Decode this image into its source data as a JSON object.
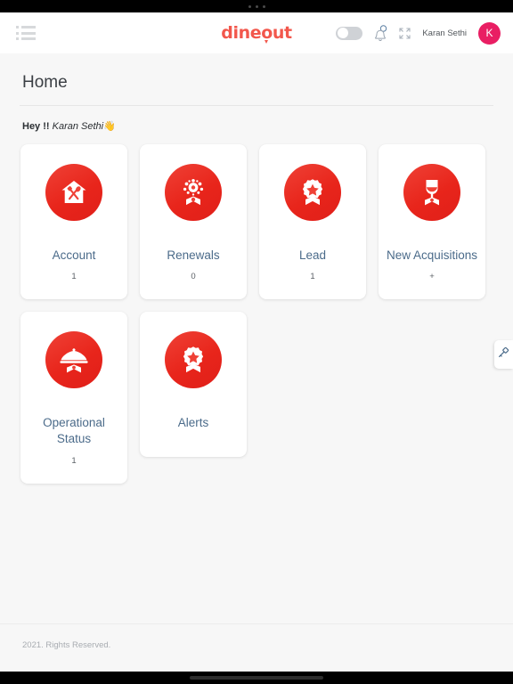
{
  "statusbar": {
    "dots": 3
  },
  "header": {
    "menu_icon": "list-menu-icon",
    "brand": "dineout",
    "toggle_state": "off",
    "bell_icon": "notification-bell-icon",
    "fullscreen_icon": "fullscreen-expand-icon",
    "username": "Karan Sethi",
    "avatar_initial": "K",
    "avatar_color": "#e91e63",
    "brand_color": "#f2574c"
  },
  "page": {
    "title": "Home",
    "greeting_prefix": "Hey !!",
    "greeting_name": "Karan Sethi",
    "greeting_emoji": "👋"
  },
  "cards": [
    {
      "id": "account",
      "label": "Account",
      "count": "1",
      "icon": "restaurant-house-icon"
    },
    {
      "id": "renewals",
      "label": "Renewals",
      "count": "0",
      "icon": "firework-ribbon-icon"
    },
    {
      "id": "lead",
      "label": "Lead",
      "count": "1",
      "icon": "star-rosette-icon"
    },
    {
      "id": "new-acquisitions",
      "label": "New Acquisitions",
      "count": "+",
      "icon": "wine-glass-icon"
    },
    {
      "id": "operational-status",
      "label": "Operational Status",
      "count": "1",
      "icon": "food-cloche-icon"
    },
    {
      "id": "alerts",
      "label": "Alerts",
      "count": "",
      "icon": "star-rosette-icon"
    }
  ],
  "side_handle": {
    "icon": "key-icon"
  },
  "footer": {
    "copyright": "2021. Rights Reserved."
  }
}
